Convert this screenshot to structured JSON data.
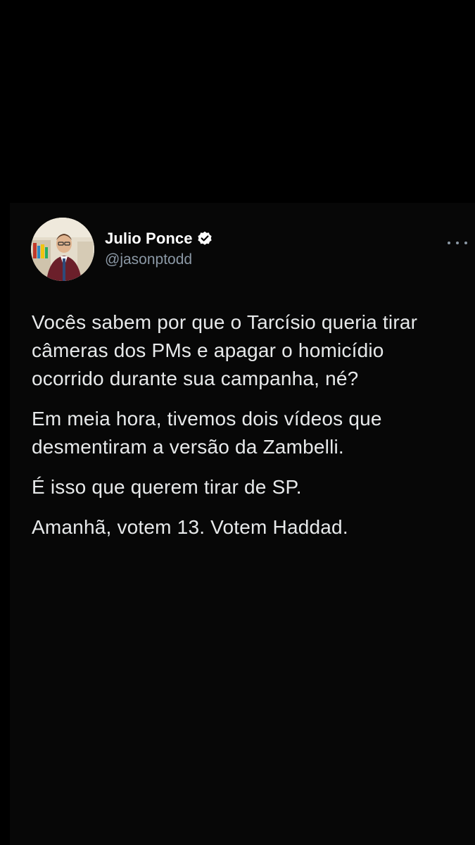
{
  "tweet": {
    "author": {
      "name": "Julio Ponce",
      "handle": "@jasonptodd",
      "verified_icon": "verified-badge-icon",
      "avatar_icon": "profile-photo"
    },
    "more_icon": "more-options-icon",
    "paragraphs": [
      "Vocês sabem por que o Tarcísio queria tirar câmeras dos PMs e apagar o homicídio ocorrido durante sua campanha, né?",
      "Em meia hora, tivemos dois vídeos que desmentiram a versão da Zambelli.",
      "É isso que querem tirar de SP.",
      "Amanhã, votem 13. Votem Haddad."
    ]
  },
  "colors": {
    "background": "#000000",
    "card": "#070707",
    "text": "#e7e9ea",
    "secondary_text": "#8b98a5"
  }
}
